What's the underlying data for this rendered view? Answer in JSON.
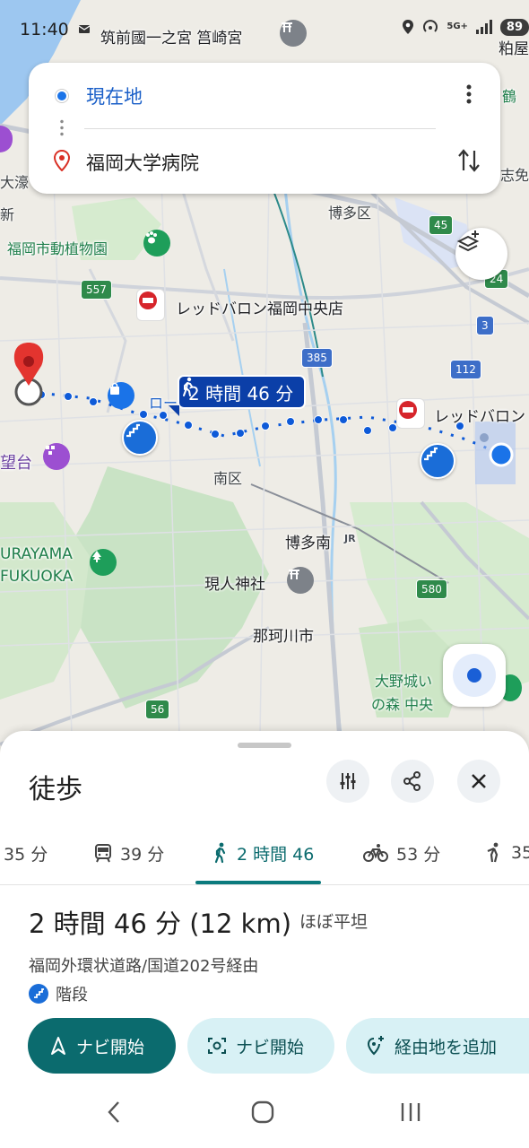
{
  "status_bar": {
    "time": "11:40",
    "network": "5G+",
    "battery": "89"
  },
  "map": {
    "labels": {
      "place_top": "筑前國一之宮 筥崎宮",
      "wada": "粕屋",
      "ohori": "大濠",
      "shin": "新",
      "botanical": "福岡市動植物園",
      "hakata_ku": "博多区",
      "redbaron_central": "レッドバロン福岡中央店",
      "minami_ku": "南区",
      "hakata_minami": "博多南",
      "genjin": "現人神社",
      "nakagawa": "那珂川市",
      "urayama": "URAYAMA",
      "fukuoka": "FUKUOKA",
      "bodai": "望台",
      "redbaron_east": "レッドバロン",
      "onojo1": "大野城い",
      "onojo2": "の森 中央",
      "shime": "志免",
      "tsuru": "鶴",
      "road_partial": "ロー",
      "jr": "JR"
    },
    "route_badges": {
      "r557": "557",
      "r385": "385",
      "r112": "112",
      "r45": "45",
      "r24": "24",
      "r3": "3",
      "r580": "580",
      "r56": "56"
    },
    "walk_time_badge": "2 時間 46 分"
  },
  "directions_card": {
    "origin": "現在地",
    "destination": "福岡大学病院"
  },
  "sheet": {
    "title": "徒歩",
    "modes": [
      {
        "label": "35 分",
        "icon": "car-icon"
      },
      {
        "label": "39 分",
        "icon": "train-icon"
      },
      {
        "label": "2 時間 46",
        "icon": "walk-icon"
      },
      {
        "label": "53 分",
        "icon": "bike-icon"
      },
      {
        "label": "35",
        "icon": "rideshare-icon"
      }
    ],
    "summary_time": "2 時間 46 分",
    "summary_distance": "(12 km)",
    "summary_terrain": "ほぼ平坦",
    "via": "福岡外環状道路/国道202号経由",
    "stairs_label": "階段",
    "buttons": {
      "start_nav": "ナビ開始",
      "start_nav_ar": "ナビ開始",
      "add_stop": "経由地を追加"
    }
  }
}
